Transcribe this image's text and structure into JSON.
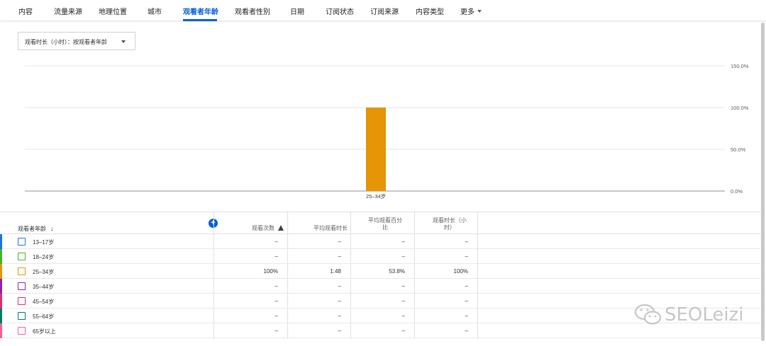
{
  "tabs": [
    {
      "label": "内容"
    },
    {
      "label": "流量来源"
    },
    {
      "label": "地理位置"
    },
    {
      "label": "城市"
    },
    {
      "label": "观看者年龄",
      "active": true
    },
    {
      "label": "观看者性别"
    },
    {
      "label": "日期"
    },
    {
      "label": "订阅状态"
    },
    {
      "label": "订阅来源"
    },
    {
      "label": "内容类型"
    },
    {
      "label": "更多"
    }
  ],
  "dropdown": {
    "label": "观看时长（小时）：按观看者年龄"
  },
  "chart_data": {
    "type": "bar",
    "categories": [
      "25–34岁"
    ],
    "values": [
      100.0
    ],
    "ylim": [
      0,
      150
    ],
    "yticks": [
      "0.0%",
      "50.0%",
      "100.0%",
      "150.0%"
    ],
    "ytick_values": [
      0,
      50,
      100,
      150
    ],
    "grid": true,
    "bar_color": "#e59506"
  },
  "table": {
    "headers": {
      "dimension": "观看者年龄",
      "views": "观看次数",
      "avg_view_duration": "平均观看时长",
      "avg_percent_line1": "平均观看百分",
      "avg_percent_line2": "比",
      "watch_time_line1": "观看时长（小",
      "watch_time_line2": "时）"
    },
    "rows": [
      {
        "label": "13–17岁",
        "color": "#1a73e8",
        "views": "–",
        "avg_duration": "–",
        "avg_percent": "–",
        "watch_time": "–"
      },
      {
        "label": "18–24岁",
        "color": "#4caf2a",
        "views": "–",
        "avg_duration": "–",
        "avg_percent": "–",
        "watch_time": "–"
      },
      {
        "label": "25–34岁",
        "color": "#e59506",
        "views": "100%",
        "avg_duration": "1:48",
        "avg_percent": "53.8%",
        "watch_time": "100%"
      },
      {
        "label": "35–44岁",
        "color": "#8e24aa",
        "views": "–",
        "avg_duration": "–",
        "avg_percent": "–",
        "watch_time": "–"
      },
      {
        "label": "45–54岁",
        "color": "#d6336c",
        "views": "–",
        "avg_duration": "–",
        "avg_percent": "–",
        "watch_time": "–"
      },
      {
        "label": "55–64岁",
        "color": "#00796b",
        "views": "–",
        "avg_duration": "–",
        "avg_percent": "–",
        "watch_time": "–"
      },
      {
        "label": "65岁以上",
        "color": "#f06292",
        "views": "–",
        "avg_duration": "–",
        "avg_percent": "–",
        "watch_time": "–"
      }
    ]
  },
  "watermark": {
    "text": "SEOLeizi"
  },
  "colors": {
    "accent": "#065fd4",
    "divider": "#e0e0e0"
  }
}
